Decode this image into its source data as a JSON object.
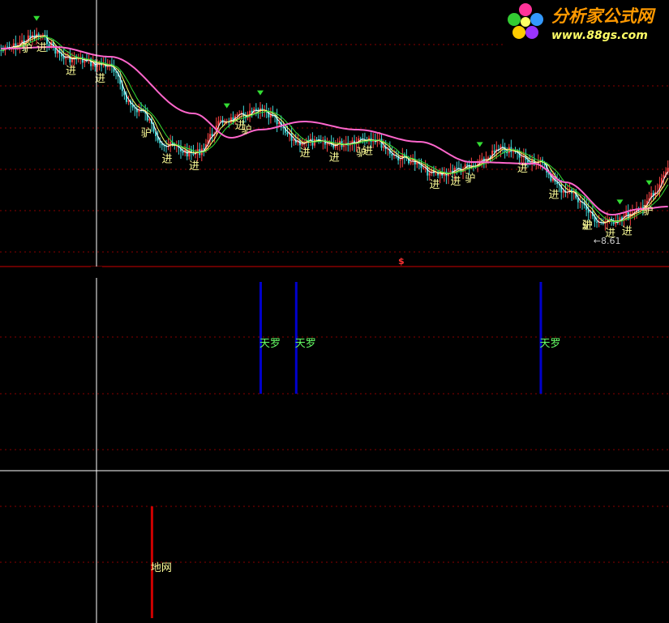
{
  "watermark": {
    "brand_text": "分析家公式网",
    "url_text": "www.88gs.com"
  },
  "colors": {
    "background": "#000000",
    "grid": "#8a0000",
    "candle_up": "#ff4444",
    "candle_down": "#40d8d8",
    "ma_white": "#ffffff",
    "ma_yellow": "#ffff66",
    "ma_green": "#33dd33",
    "ma_pink": "#ff66cc",
    "signal_label": "#ffff99",
    "tianluo_bar": "#0000cc",
    "tianluo_text": "#66ff66",
    "diwang_bar": "#cc0000",
    "diwang_text": "#ffff99",
    "cursor": "#ffffff",
    "divider": "#cc0000"
  },
  "chart_data": [
    {
      "type": "candlestick",
      "panel": "price",
      "low_marker_text": "8.61",
      "top_marker_text": "$",
      "signal_labels": [
        "进",
        "驴"
      ],
      "buy_points": [
        {
          "bar": 20,
          "label": "进"
        },
        {
          "bar": 34,
          "label": "进"
        },
        {
          "bar": 48,
          "label": "进"
        },
        {
          "bar": 80,
          "label": "进"
        },
        {
          "bar": 93,
          "label": "进"
        },
        {
          "bar": 115,
          "label": "进"
        },
        {
          "bar": 146,
          "label": "进"
        },
        {
          "bar": 160,
          "label": "进"
        },
        {
          "bar": 176,
          "label": "进"
        },
        {
          "bar": 208,
          "label": "进"
        },
        {
          "bar": 218,
          "label": "进"
        },
        {
          "bar": 250,
          "label": "进"
        },
        {
          "bar": 265,
          "label": "进"
        },
        {
          "bar": 281,
          "label": "进"
        },
        {
          "bar": 292,
          "label": "进"
        },
        {
          "bar": 300,
          "label": "进"
        }
      ],
      "lv_points": [
        {
          "bar": 13,
          "label": "驴"
        },
        {
          "bar": 70,
          "label": "驴"
        },
        {
          "bar": 118,
          "label": "驴"
        },
        {
          "bar": 173,
          "label": "驴"
        },
        {
          "bar": 225,
          "label": "驴"
        },
        {
          "bar": 281,
          "label": "驴"
        },
        {
          "bar": 310,
          "label": "驴"
        }
      ]
    },
    {
      "type": "bar",
      "panel": "tianluo",
      "label": "天罗",
      "bars": [
        124,
        141,
        258,
        356
      ]
    },
    {
      "type": "bar",
      "panel": "diwang",
      "label": "地网",
      "bars": [
        72,
        322
      ]
    }
  ]
}
